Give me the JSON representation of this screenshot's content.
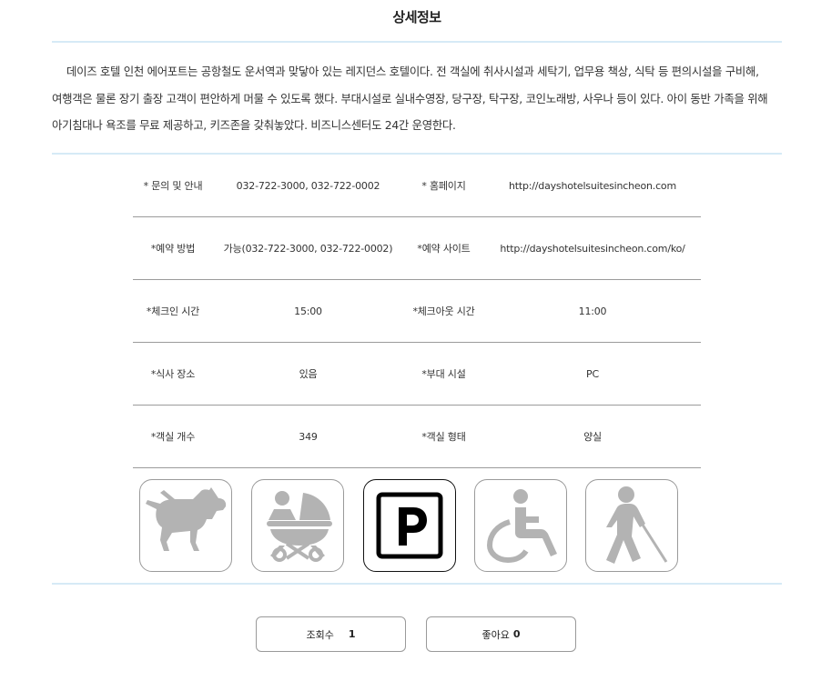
{
  "title": "상세정보",
  "description": "데이즈 호텔 인천 에어포트는 공항철도 운서역과 맞닿아 있는 레지던스 호텔이다. 전 객실에 취사시설과 세탁기, 업무용 책상, 식탁 등 편의시설을 구비해, 여행객은 물론 장기 출장 고객이 편안하게 머물 수 있도록 했다. 부대시설로 실내수영장, 당구장, 탁구장, 코인노래방, 사우나 등이 있다. 아이 동반 가족을 위해 아기침대나 욕조를 무료 제공하고, 키즈존을 갖춰놓았다. 비즈니스센터도 24간 운영한다.",
  "info_rows": [
    {
      "label1": "* 문의 및 안내",
      "value1": "032-722-3000, 032-722-0002",
      "label2": "* 홈페이지",
      "value2": "http://dayshotelsuitesincheon.com"
    },
    {
      "label1": "*예약 방법",
      "value1": "가능(032-722-3000, 032-722-0002)",
      "label2": "*예약 사이트",
      "value2": "http://dayshotelsuitesincheon.com/ko/"
    },
    {
      "label1": "*체크인 시간",
      "value1": "15:00",
      "label2": "*체크아웃 시간",
      "value2": "11:00"
    },
    {
      "label1": "*식사 장소",
      "value1": "있음",
      "label2": "*부대 시설",
      "value2": "PC"
    },
    {
      "label1": "*객실 개수",
      "value1": "349",
      "label2": "*객실 형태",
      "value2": "양실"
    }
  ],
  "facility_icons": [
    {
      "name": "pet-icon",
      "active": false
    },
    {
      "name": "stroller-icon",
      "active": false
    },
    {
      "name": "parking-icon",
      "active": true
    },
    {
      "name": "wheelchair-icon",
      "active": false
    },
    {
      "name": "visually-impaired-icon",
      "active": false
    }
  ],
  "stats": {
    "views_label": "조회수",
    "views_count": "1",
    "likes_label": "좋아요",
    "likes_count": "0"
  },
  "colors": {
    "rule": "#d6eaf6",
    "icon_inactive": "#b3b3b3",
    "icon_active": "#000000"
  }
}
